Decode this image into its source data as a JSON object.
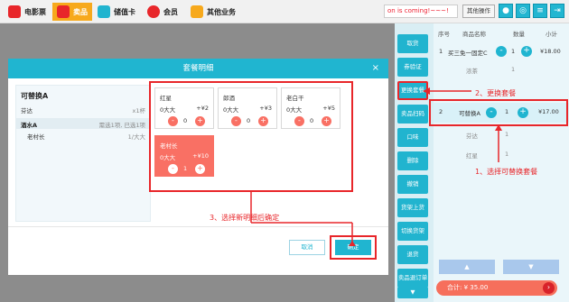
{
  "nav": {
    "tabs": [
      {
        "label": "电影票",
        "icon": "film-icon",
        "color": "#e8262a"
      },
      {
        "label": "卖品",
        "icon": "popcorn-icon",
        "color": "#e8262a"
      },
      {
        "label": "储值卡",
        "icon": "card-icon",
        "color": "#21b4cf"
      },
      {
        "label": "会员",
        "icon": "member-icon",
        "color": "#e8262a"
      },
      {
        "label": "其他业务",
        "icon": "other-icon",
        "color": "#f7a91c"
      }
    ],
    "marquee": "on is coming!~~~!",
    "other_ops": "其他操作"
  },
  "sidebar": {
    "buttons": [
      "取货",
      "券验证",
      "更换套餐",
      "卖品扫码",
      "口味",
      "删除",
      "撤销",
      "货架上货",
      "切换货架",
      "退货",
      "卖品退订单"
    ]
  },
  "order": {
    "headers": {
      "no": "序号",
      "name": "商品名称",
      "qty": "数量",
      "subtotal": "小计"
    },
    "rows": [
      {
        "no": "1",
        "name": "买三免一固定C",
        "qty": "1",
        "price": "¥18.00"
      },
      {
        "sub": "浓茶",
        "qty": "1"
      },
      {
        "no": "2",
        "name": "可替换A",
        "qty": "1",
        "price": "¥17.00"
      },
      {
        "sub": "芬达",
        "qty": "1"
      },
      {
        "sub": "红星",
        "qty": "1"
      }
    ],
    "total": "合计: ¥ 35.00",
    "go": "›"
  },
  "modal": {
    "title": "套餐明细",
    "close": "×",
    "left": {
      "title": "可替换A",
      "items": [
        {
          "name": "芬达",
          "qty": "x1杯"
        },
        {
          "name": "酒水A",
          "qty": "需选1项, 已选1项",
          "bold": true
        },
        {
          "name": "老村长",
          "qty": "1/大大"
        }
      ]
    },
    "options": [
      {
        "name": "红星",
        "size": "0大大",
        "price": "+¥2",
        "qty": "0"
      },
      {
        "name": "郎酒",
        "size": "0大大",
        "price": "+¥3",
        "qty": "0"
      },
      {
        "name": "老白干",
        "size": "0大大",
        "price": "+¥5",
        "qty": "0"
      },
      {
        "name": "老村长",
        "size": "0大大",
        "price": "+¥10",
        "qty": "1"
      }
    ],
    "cancel": "取消",
    "confirm": "确定"
  },
  "annotations": {
    "step1": "1、选择可替换套餐",
    "step2": "2、更换套餐",
    "step3": "3、选择新明细后确定"
  },
  "colors": {
    "accent": "#20b5d0",
    "red": "#e8262a",
    "selected": "#f97064"
  }
}
